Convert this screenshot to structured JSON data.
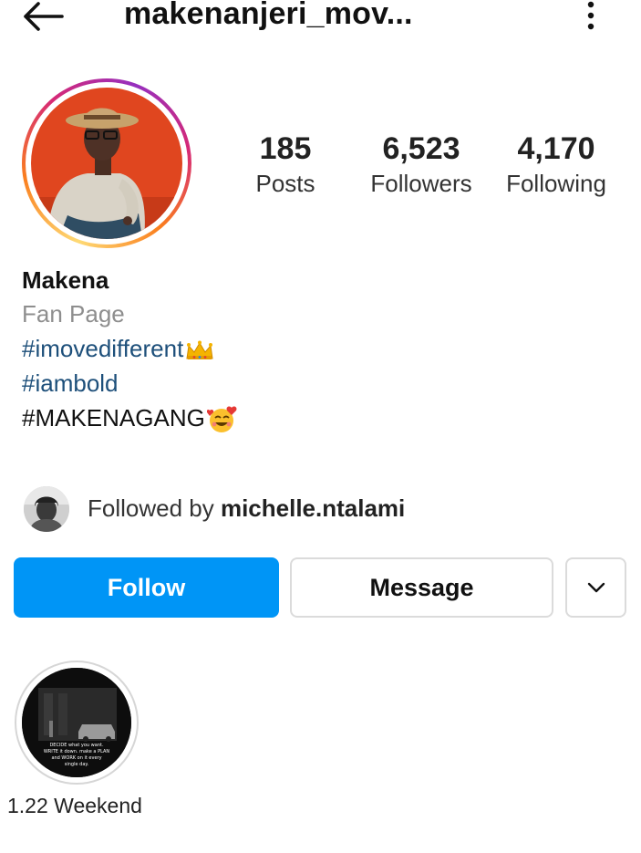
{
  "header": {
    "username": "makenanjeri_mov...",
    "back_icon": "arrow-left-icon",
    "more_icon": "more-vertical-icon"
  },
  "stats": {
    "posts": {
      "value": "185",
      "label": "Posts"
    },
    "followers": {
      "value": "6,523",
      "label": "Followers"
    },
    "following": {
      "value": "4,170",
      "label": "Following"
    }
  },
  "bio": {
    "name": "Makena",
    "category": "Fan Page",
    "lines": [
      "#imovedifferent",
      "#iambold",
      "#MAKENAGANG"
    ],
    "emojis": [
      "crown-emoji",
      "smiling-face-with-hearts-emoji"
    ]
  },
  "mutual": {
    "prefix": "Followed by",
    "username": "michelle.ntalami"
  },
  "buttons": {
    "follow": "Follow",
    "message": "Message",
    "more_icon": "chevron-down-icon"
  },
  "highlights": [
    {
      "label": "1.22 Weekend",
      "story_text": [
        "DECIDE what you want.",
        "WRITE it down. make a PLAN",
        "and WORK on it every",
        "single day."
      ]
    }
  ],
  "colors": {
    "accent": "#0095f6",
    "hashtag": "#1d4f7a",
    "muted": "#8e8e8e",
    "avatar_bg": "#e0461f"
  }
}
